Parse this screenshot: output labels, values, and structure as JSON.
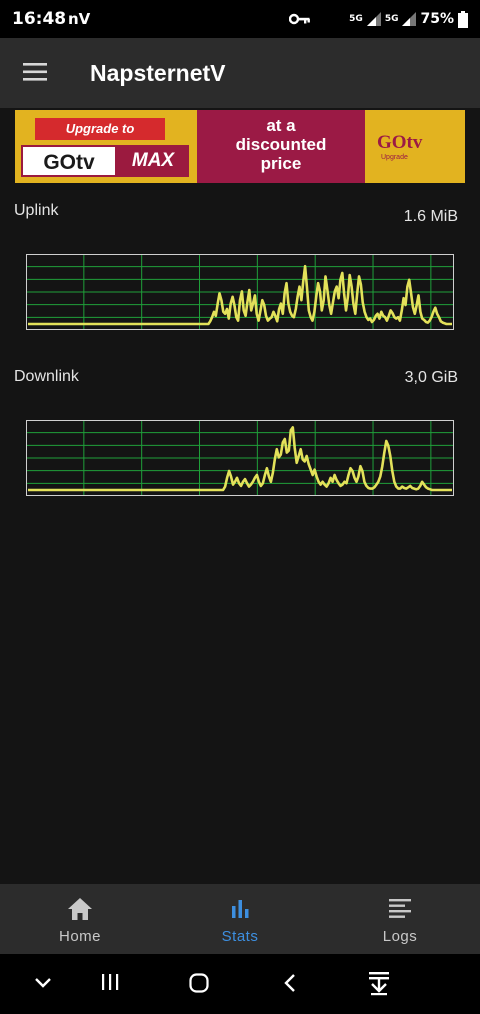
{
  "status_bar": {
    "time": "16:48",
    "carrier": "nV",
    "net1": "5G",
    "net2": "5G",
    "battery": "75%"
  },
  "app_bar": {
    "title": "NapsternetV",
    "menu_icon": "hamburger-menu-icon"
  },
  "banner": {
    "tag": "Upgrade to",
    "logo": "GOtv",
    "max": "MAX",
    "headline_line1": "at a",
    "headline_line2": "discounted",
    "headline_line3": "price",
    "right_logo": "GOtv",
    "right_sub": "Upgrade",
    "colors": {
      "background": "#e2b320",
      "accent": "#9b1a45",
      "tag": "#d52a2d"
    }
  },
  "stats": {
    "uplink": {
      "label": "Uplink",
      "value": "1.6 MiB",
      "series": [
        0,
        0,
        0,
        0,
        0,
        0,
        0,
        0,
        0,
        0,
        0,
        0,
        0,
        0,
        0,
        0,
        0,
        0,
        0,
        0,
        0,
        0,
        0,
        0,
        0,
        0,
        0,
        0,
        0,
        0,
        0,
        0,
        0,
        0,
        0,
        0,
        0,
        0,
        0,
        0,
        0,
        0,
        0,
        0,
        0,
        0,
        0,
        0,
        0,
        0,
        0,
        0,
        0,
        0,
        0,
        0,
        0,
        0,
        0,
        0,
        0,
        0,
        0,
        0,
        0,
        0,
        0,
        0,
        0,
        0,
        0,
        0,
        0,
        0,
        0,
        0,
        0,
        0,
        0,
        0,
        0,
        0,
        0,
        0,
        0,
        0,
        0,
        0,
        0,
        0,
        0,
        0,
        0,
        0,
        0,
        0,
        0,
        0,
        0.04,
        0.1,
        0.18,
        0.12,
        0.3,
        0.45,
        0.35,
        0.18,
        0.15,
        0.22,
        0.08,
        0.3,
        0.4,
        0.28,
        0.1,
        0.05,
        0.35,
        0.48,
        0.2,
        0.12,
        0.32,
        0.5,
        0.2,
        0.3,
        0.42,
        0.15,
        0.05,
        0.2,
        0.35,
        0.28,
        0.12,
        0.05,
        0.08,
        0.1,
        0.18,
        0.12,
        0.04,
        0.22,
        0.3,
        0.15,
        0.45,
        0.6,
        0.3,
        0.18,
        0.12,
        0.1,
        0.22,
        0.4,
        0.55,
        0.35,
        0.62,
        0.85,
        0.55,
        0.2,
        0.1,
        0.05,
        0.18,
        0.4,
        0.6,
        0.48,
        0.2,
        0.35,
        0.7,
        0.5,
        0.28,
        0.15,
        0.32,
        0.48,
        0.55,
        0.38,
        0.65,
        0.75,
        0.45,
        0.2,
        0.4,
        0.72,
        0.55,
        0.3,
        0.15,
        0.45,
        0.7,
        0.58,
        0.32,
        0.18,
        0.1,
        0.06,
        0.08,
        0.03,
        0.06,
        0.12,
        0.15,
        0.08,
        0.18,
        0.12,
        0.1,
        0.05,
        0.12,
        0.2,
        0.16,
        0.1,
        0.08,
        0.1,
        0.05,
        0.2,
        0.38,
        0.28,
        0.55,
        0.65,
        0.45,
        0.25,
        0.15,
        0.28,
        0.42,
        0.18,
        0.08,
        0.06,
        0.03,
        0.02,
        0.05,
        0.1,
        0.18,
        0.24,
        0.15,
        0.1,
        0.04,
        0.02,
        0.01,
        0,
        0,
        0,
        0
      ],
      "ylim": [
        0,
        1
      ]
    },
    "downlink": {
      "label": "Downlink",
      "value": "3,0 GiB",
      "series": [
        0,
        0,
        0,
        0,
        0,
        0,
        0,
        0,
        0,
        0,
        0,
        0,
        0,
        0,
        0,
        0,
        0,
        0,
        0,
        0,
        0,
        0,
        0,
        0,
        0,
        0,
        0,
        0,
        0,
        0,
        0,
        0,
        0,
        0,
        0,
        0,
        0,
        0,
        0,
        0,
        0,
        0,
        0,
        0,
        0,
        0,
        0,
        0,
        0,
        0,
        0,
        0,
        0,
        0,
        0,
        0,
        0,
        0,
        0,
        0,
        0,
        0,
        0,
        0,
        0,
        0,
        0,
        0,
        0,
        0,
        0,
        0,
        0,
        0,
        0,
        0,
        0,
        0,
        0,
        0,
        0,
        0,
        0,
        0,
        0,
        0,
        0,
        0,
        0,
        0,
        0,
        0,
        0,
        0,
        0,
        0,
        0,
        0,
        0,
        0.05,
        0.18,
        0.28,
        0.2,
        0.08,
        0.12,
        0.18,
        0.1,
        0.06,
        0.12,
        0.16,
        0.1,
        0.05,
        0.08,
        0.12,
        0.18,
        0.22,
        0.12,
        0.06,
        0.1,
        0.22,
        0.32,
        0.2,
        0.12,
        0.25,
        0.45,
        0.6,
        0.48,
        0.52,
        0.7,
        0.75,
        0.55,
        0.58,
        0.88,
        0.92,
        0.62,
        0.4,
        0.5,
        0.6,
        0.45,
        0.42,
        0.5,
        0.38,
        0.3,
        0.22,
        0.3,
        0.2,
        0.12,
        0.08,
        0.12,
        0.08,
        0.05,
        0.1,
        0.18,
        0.12,
        0.22,
        0.15,
        0.1,
        0.06,
        0.08,
        0.12,
        0.1,
        0.22,
        0.32,
        0.28,
        0.18,
        0.12,
        0.2,
        0.35,
        0.28,
        0.12,
        0.06,
        0.03,
        0.02,
        0.02,
        0.04,
        0.08,
        0.12,
        0.2,
        0.35,
        0.55,
        0.72,
        0.65,
        0.5,
        0.28,
        0.12,
        0.05,
        0.02,
        0.02,
        0.05,
        0.03,
        0.02,
        0.04,
        0.06,
        0.03,
        0.02,
        0.01,
        0.02,
        0.06,
        0.12,
        0.08,
        0.04,
        0.02,
        0.01,
        0,
        0,
        0,
        0,
        0,
        0,
        0,
        0,
        0,
        0,
        0
      ],
      "ylim": [
        0,
        1
      ]
    },
    "line_color": "#e3e15a",
    "grid_color": "#1fa03a"
  },
  "bottom_nav": {
    "items": [
      {
        "label": "Home",
        "icon": "home-icon",
        "active": false
      },
      {
        "label": "Stats",
        "icon": "bar-chart-icon",
        "active": true
      },
      {
        "label": "Logs",
        "icon": "list-lines-icon",
        "active": false
      }
    ],
    "colors": {
      "active": "#3d8fe0",
      "inactive": "#c8c8c8"
    }
  },
  "system_nav": {
    "buttons": [
      "chevron-down-icon",
      "recent-apps-icon",
      "home-circle-icon",
      "back-icon",
      "download-icon"
    ]
  }
}
